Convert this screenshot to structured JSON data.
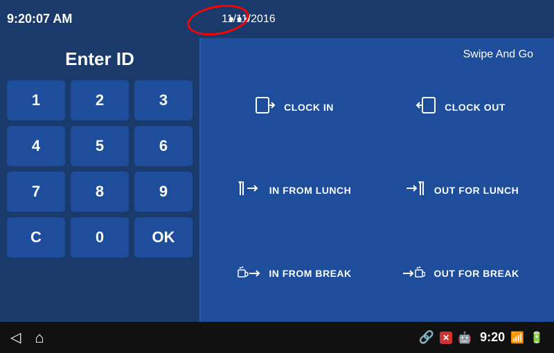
{
  "topBar": {
    "time": "9:20:07 AM",
    "date": "11/11/2016",
    "menuDots": "•••"
  },
  "leftPanel": {
    "title": "Enter ID",
    "buttons": [
      {
        "label": "1"
      },
      {
        "label": "2"
      },
      {
        "label": "3"
      },
      {
        "label": "4"
      },
      {
        "label": "5"
      },
      {
        "label": "6"
      },
      {
        "label": "7"
      },
      {
        "label": "8"
      },
      {
        "label": "9"
      },
      {
        "label": "C"
      },
      {
        "label": "0"
      },
      {
        "label": "OK"
      }
    ]
  },
  "rightPanel": {
    "swipeLabel": "Swipe And Go",
    "actions": [
      {
        "id": "clock-in",
        "label": "CLOCK IN",
        "icon": "🚪→"
      },
      {
        "id": "clock-out",
        "label": "CLOCK OUT",
        "icon": "→🚪"
      },
      {
        "id": "in-from-lunch",
        "label": "IN FROM LUNCH",
        "icon": "🍴→"
      },
      {
        "id": "out-for-lunch",
        "label": "OUT FOR LUNCH",
        "icon": "→🍴"
      },
      {
        "id": "in-from-break",
        "label": "IN FROM BREAK",
        "icon": "☕→"
      },
      {
        "id": "out-for-break",
        "label": "OUT FOR BREAK",
        "icon": "→☕"
      }
    ]
  },
  "bottomBar": {
    "time": "9:20",
    "navBack": "◁",
    "navHome": "⌂"
  }
}
